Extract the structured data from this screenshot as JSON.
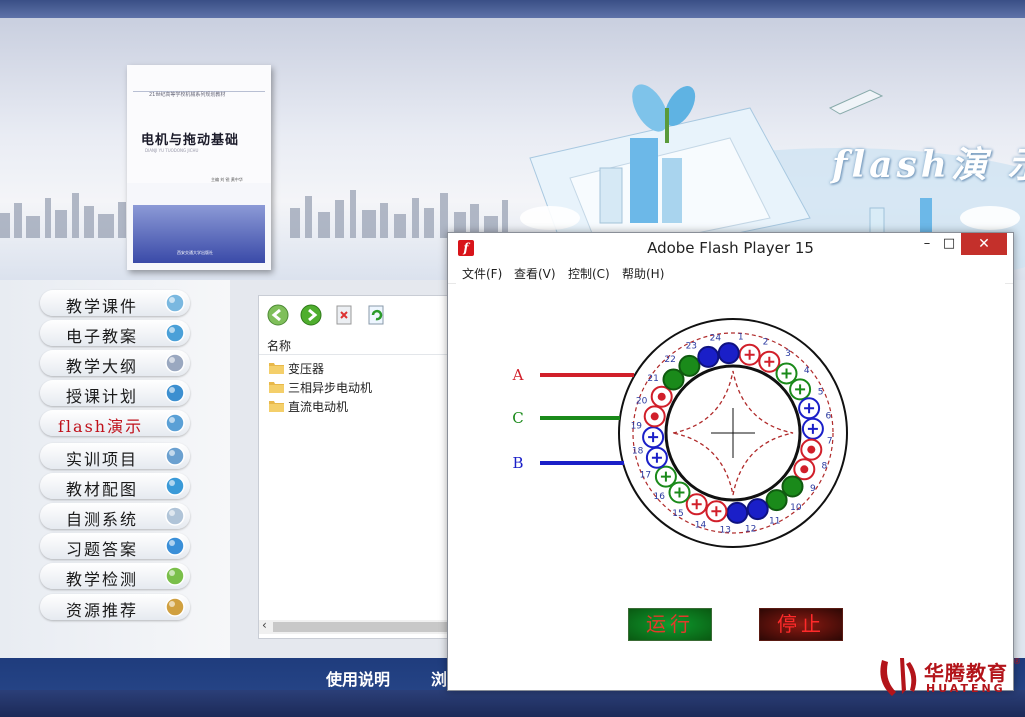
{
  "book": {
    "series": "21世纪高等学校机械系列规划教材",
    "title": "电机与拖动基础",
    "subtitle": "DIANJI YU TUODONG JICHU",
    "authors": "主编 刘 锐 黄中华",
    "publisher": "西安交通大学出版社"
  },
  "banner": {
    "flash_logo": "flash演 示"
  },
  "sidebar": {
    "items": [
      {
        "label": "教学课件",
        "icon": "courseware-icon"
      },
      {
        "label": "电子教案",
        "icon": "info-icon"
      },
      {
        "label": "教学大纲",
        "icon": "news-icon"
      },
      {
        "label": "授课计划",
        "icon": "globe-icon"
      },
      {
        "label": "flash演示",
        "icon": "magnifier-icon",
        "active": true
      },
      {
        "label": "实训项目",
        "icon": "tools-icon"
      },
      {
        "label": "教材配图",
        "icon": "images-icon"
      },
      {
        "label": "自测系统",
        "icon": "mail-icon"
      },
      {
        "label": "习题答案",
        "icon": "ie-icon"
      },
      {
        "label": "教学检测",
        "icon": "plant-icon"
      },
      {
        "label": "资源推荐",
        "icon": "chart-icon"
      }
    ]
  },
  "explorer": {
    "column_header": "名称",
    "folders": [
      "变压器",
      "三相异步电动机",
      "直流电动机"
    ]
  },
  "bottom": {
    "items": [
      "使用说明",
      "浏"
    ]
  },
  "flash_player": {
    "title": "Adobe Flash Player 15",
    "menus": [
      "文件(F)",
      "查看(V)",
      "控制(C)",
      "帮助(H)"
    ],
    "phases": [
      {
        "label": "A",
        "color": "#d11f2a"
      },
      {
        "label": "C",
        "color": "#1a8a1a"
      },
      {
        "label": "B",
        "color": "#1a1fc8"
      }
    ],
    "slot_numbers": [
      "1",
      "2",
      "3",
      "4",
      "5",
      "6",
      "7",
      "8",
      "9",
      "10",
      "11",
      "12",
      "13",
      "14",
      "15",
      "16",
      "17",
      "18",
      "19",
      "20",
      "21",
      "22",
      "23",
      "24"
    ],
    "run_label": "运行",
    "stop_label": "停止"
  },
  "logo": {
    "cn": "华腾教育",
    "en": "HUATENG",
    "reg": "®"
  }
}
